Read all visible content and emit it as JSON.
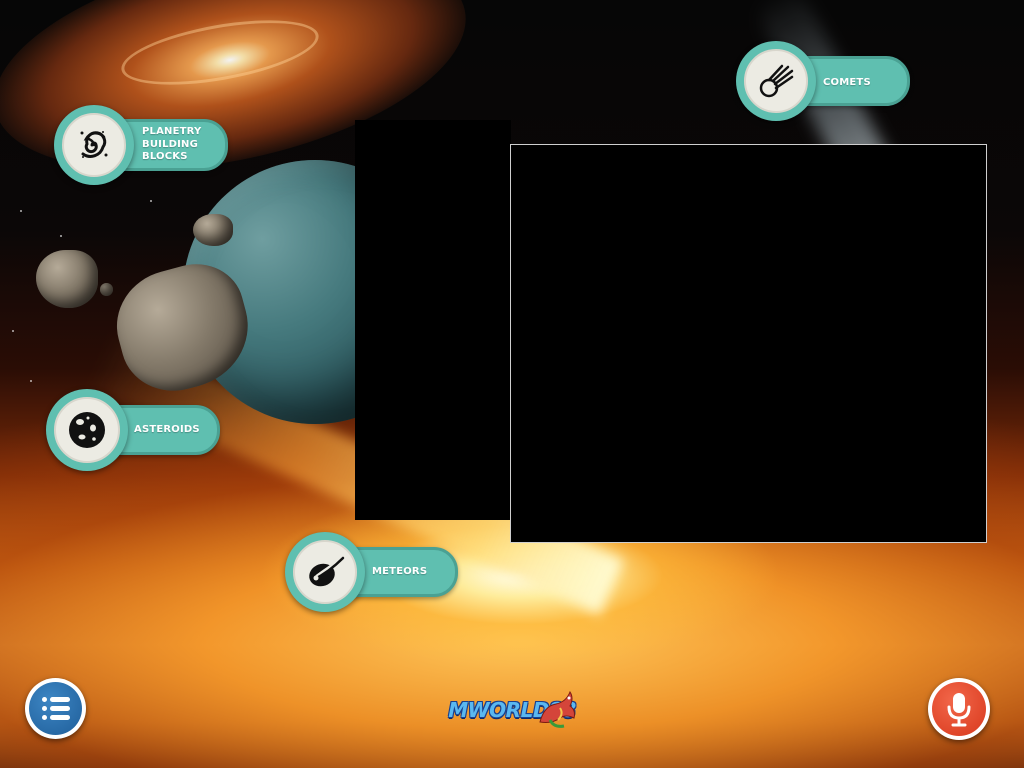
{
  "topics": {
    "planetary": {
      "label": "PLANETRY\nBUILDING\nBLOCKS",
      "icon": "galaxy-icon"
    },
    "asteroids": {
      "label": "ASTEROIDS",
      "icon": "asteroid-icon"
    },
    "meteors": {
      "label": "METEORS",
      "icon": "meteor-icon"
    },
    "comets": {
      "label": "COMETS",
      "icon": "comet-icon"
    }
  },
  "controls": {
    "menu_icon": "list-menu-icon",
    "mic_icon": "microphone-icon"
  },
  "brand": {
    "logo_text": "MWORLD88"
  },
  "colors": {
    "topic_button": "#5fbfb0",
    "topic_icon_bg": "#ecebe3",
    "menu_button": "#2a71b0",
    "mic_button": "#e44a2c"
  }
}
